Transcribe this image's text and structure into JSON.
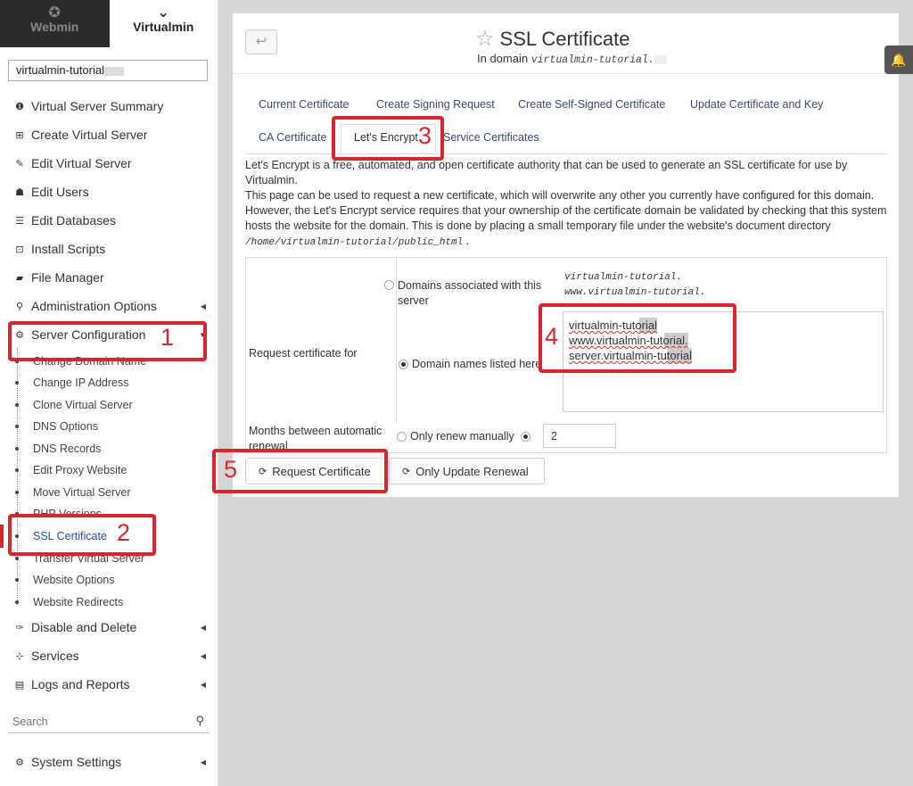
{
  "sidebar": {
    "tab_webmin": "Webmin",
    "tab_virtualmin": "Virtualmin",
    "domain_select": "virtualmin-tutorial",
    "menu": [
      {
        "label": "Virtual Server Summary",
        "icon": "info-icon"
      },
      {
        "label": "Create Virtual Server",
        "icon": "plus-square-icon"
      },
      {
        "label": "Edit Virtual Server",
        "icon": "edit-icon"
      },
      {
        "label": "Edit Users",
        "icon": "users-icon"
      },
      {
        "label": "Edit Databases",
        "icon": "database-icon"
      },
      {
        "label": "Install Scripts",
        "icon": "download-icon"
      },
      {
        "label": "File Manager",
        "icon": "folder-icon"
      },
      {
        "label": "Administration Options",
        "icon": "key-icon"
      },
      {
        "label": "Server Configuration",
        "icon": "gears-icon"
      }
    ],
    "submenu": [
      "Change Domain Name",
      "Change IP Address",
      "Clone Virtual Server",
      "DNS Options",
      "DNS Records",
      "Edit Proxy Website",
      "Move Virtual Server",
      "PHP Versions",
      "SSL Certificate",
      "Transfer Virtual Server",
      "Website Options",
      "Website Redirects"
    ],
    "menu_bottom": [
      {
        "label": "Disable and Delete",
        "icon": "plug-icon"
      },
      {
        "label": "Services",
        "icon": "sitemap-icon"
      },
      {
        "label": "Logs and Reports",
        "icon": "file-icon"
      }
    ],
    "search_placeholder": "Search",
    "system_settings": "System Settings"
  },
  "panel": {
    "title": "SSL Certificate",
    "subtitle_prefix": "In domain",
    "subtitle_domain": "virtualmin-tutorial."
  },
  "tabs": [
    "Current Certificate",
    "Create Signing Request",
    "Create Self-Signed Certificate",
    "Update Certificate and Key",
    "CA Certificate",
    "Let's Encrypt",
    "Service Certificates"
  ],
  "description": {
    "line1": "Let's Encrypt is a free, automated, and open certificate authority that can be used to generate an SSL certificate for use by Virtualmin.",
    "line2": "This page can be used to request a new certificate, which will overwrite any other you currently have configured for this domain. However, the Let's Encrypt service requires that your ownership of the certificate domain be validated by checking that this system hosts the website for the domain. This is done by placing a small temporary file under the website's document directory",
    "path": "/home/virtualmin-tutorial/public_html",
    "path_suffix": "."
  },
  "form": {
    "request_label": "Request certificate for",
    "option_associated": "Domains associated with this server",
    "associated_domains": [
      "virtualmin-tutorial.",
      "www.virtualmin-tutorial."
    ],
    "option_listed": "Domain names listed here",
    "listed_domains": [
      "virtualmin-tutorial",
      "www.virtualmin-tutorial.",
      "server.virtualmin-tutorial"
    ],
    "months_label": "Months between automatic renewal",
    "option_manual": "Only renew manually",
    "months_value": "2"
  },
  "buttons": {
    "request": "Request Certificate",
    "update_renewal": "Only Update Renewal"
  },
  "annotations": [
    "1",
    "2",
    "3",
    "4",
    "5"
  ],
  "colors": {
    "annotation": "#d7262e",
    "active_link": "#2b4aa8",
    "webmin_tab_bg": "#2b2b2b"
  }
}
